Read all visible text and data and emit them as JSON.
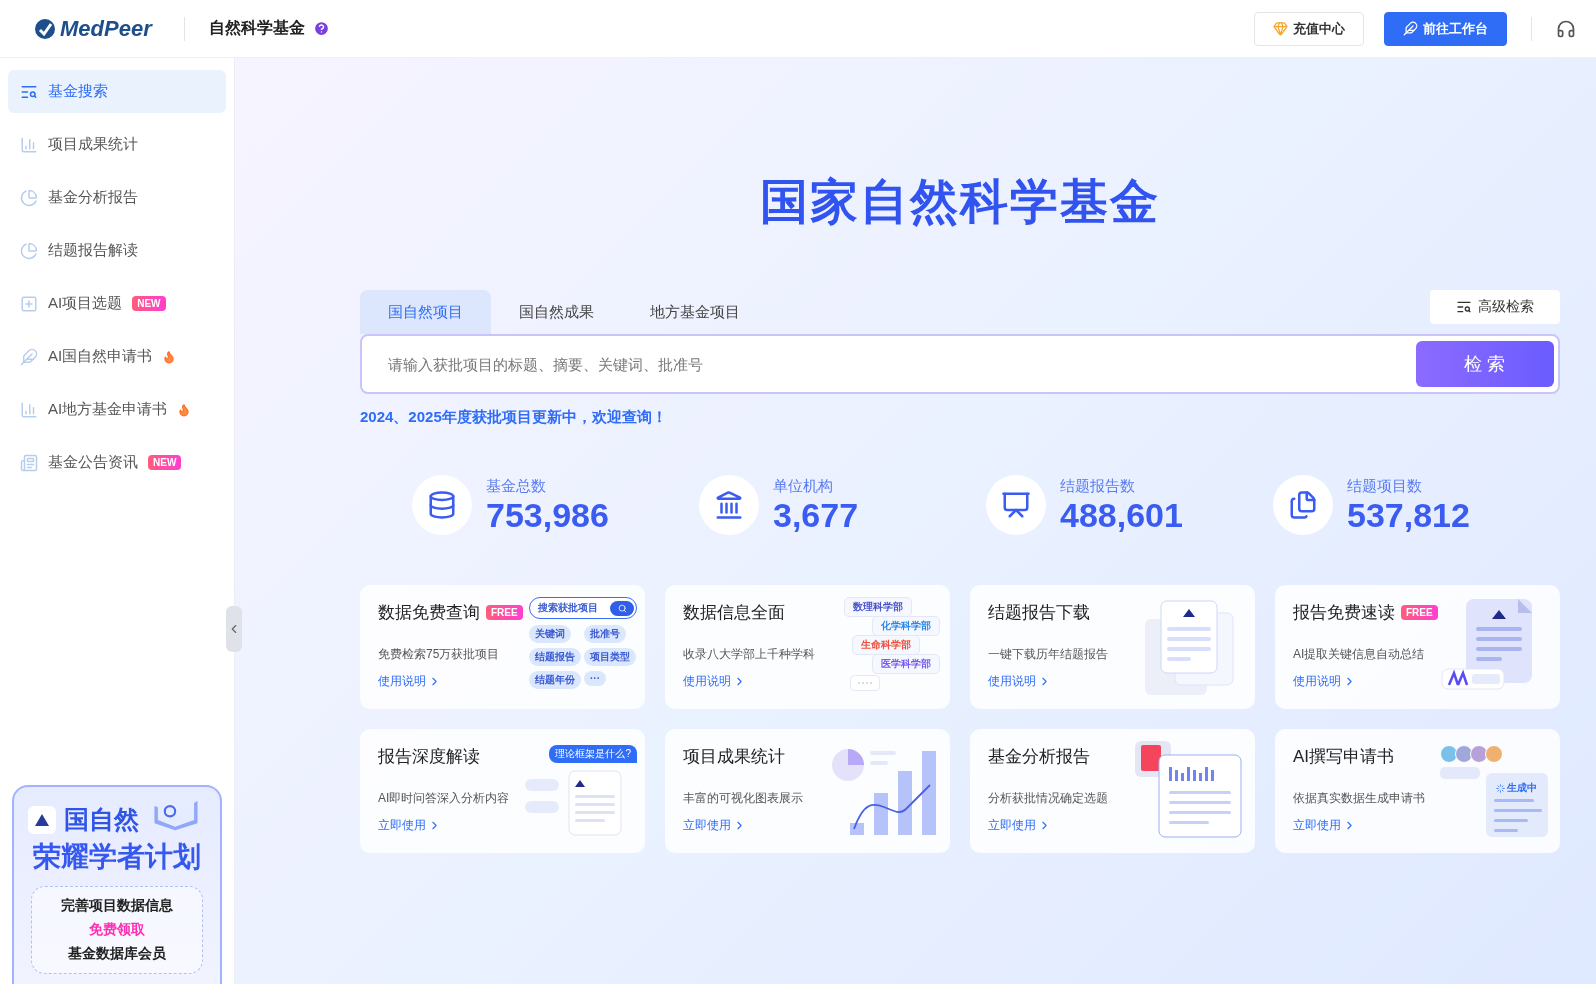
{
  "header": {
    "logo": "MedPeer",
    "title": "自然科学基金",
    "buttons": [
      {
        "label": "充值中心",
        "kind": "secondary"
      },
      {
        "label": "前往工作台",
        "kind": "primary"
      }
    ]
  },
  "sidebar": {
    "items": [
      {
        "label": "基金搜索",
        "selected": true
      },
      {
        "label": "项目成果统计",
        "selected": false
      },
      {
        "label": "基金分析报告",
        "selected": false
      },
      {
        "label": "结题报告解读",
        "selected": false
      },
      {
        "label": "AI项目选题",
        "selected": false,
        "badge": "NEW"
      },
      {
        "label": "AI国自然申请书",
        "selected": false,
        "hot": true
      },
      {
        "label": "AI地方基金申请书",
        "selected": false,
        "hot": true
      },
      {
        "label": "基金公告资讯",
        "selected": false,
        "badge": "NEW"
      }
    ]
  },
  "promo": {
    "title": "国自然",
    "subtitle": "荣耀学者计划",
    "lines": [
      {
        "text": "完善项目数据信息",
        "highlight": false
      },
      {
        "text": "免费领取",
        "highlight": true
      },
      {
        "text": "基金数据库会员",
        "highlight": false
      }
    ]
  },
  "hero": {
    "title": "国家自然科学基金"
  },
  "search": {
    "tabs": [
      {
        "label": "国自然项目",
        "selected": true
      },
      {
        "label": "国自然成果",
        "selected": false
      },
      {
        "label": "地方基金项目",
        "selected": false
      }
    ],
    "advanced": "高级检索",
    "placeholder": "请输入获批项目的标题、摘要、关键词、批准号",
    "button": "检 索",
    "notice": "2024、2025年度获批项目更新中，欢迎查询！"
  },
  "stats": [
    {
      "label": "基金总数",
      "value": "753,986"
    },
    {
      "label": "单位机构",
      "value": "3,677"
    },
    {
      "label": "结题报告数",
      "value": "488,601"
    },
    {
      "label": "结题项目数",
      "value": "537,812"
    }
  ],
  "cards": [
    {
      "title": "数据免费查询",
      "badge": "FREE",
      "desc": "免费检索75万获批项目",
      "link": "使用说明",
      "kind": "search-chips",
      "search_label": "搜索获批项目",
      "chips": [
        {
          "text": "关键词"
        },
        {
          "text": "批准号"
        },
        {
          "text": "结题报告"
        },
        {
          "text": "项目类型"
        },
        {
          "text": "结题年份"
        },
        {
          "text": "···"
        }
      ]
    },
    {
      "title": "数据信息全面",
      "desc": "收录八大学部上千种学科",
      "link": "使用说明",
      "kind": "dept-chips",
      "chips": [
        {
          "text": "数理科学部",
          "color": "#4a55c8"
        },
        {
          "text": "化学科学部",
          "color": "#2b8ae6"
        },
        {
          "text": "生命科学部",
          "color": "#f0503c"
        },
        {
          "text": "医学科学部",
          "color": "#7b5cf0"
        }
      ]
    },
    {
      "title": "结题报告下载",
      "desc": "一键下载历年结题报告",
      "link": "使用说明",
      "kind": "doc-stack"
    },
    {
      "title": "报告免费速读",
      "badge": "FREE",
      "desc": "AI提取关键信息自动总结",
      "link": "使用说明",
      "kind": "doc-ai"
    },
    {
      "title": "报告深度解读",
      "desc": "AI即时问答深入分析内容",
      "link": "立即使用",
      "kind": "chat-doc",
      "chips": [
        {
          "text": "理论框架是什么?"
        }
      ]
    },
    {
      "title": "项目成果统计",
      "desc": "丰富的可视化图表展示",
      "link": "立即使用",
      "kind": "chart"
    },
    {
      "title": "基金分析报告",
      "desc": "分析获批情况确定选题",
      "link": "立即使用",
      "kind": "pdf-report"
    },
    {
      "title": "AI撰写申请书",
      "desc": "依据真实数据生成申请书",
      "link": "立即使用",
      "kind": "avatars-doc",
      "chips": [
        {
          "text": "生成中"
        }
      ]
    }
  ]
}
